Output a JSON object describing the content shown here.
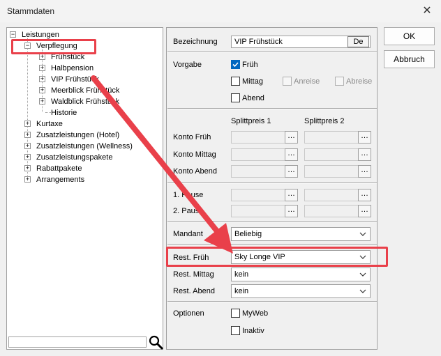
{
  "window": {
    "title": "Stammdaten",
    "close_glyph": "✕"
  },
  "tree": {
    "root": "Leistungen",
    "children": {
      "verpflegung": "Verpflegung",
      "fruehstueck": "Frühstück",
      "halbpension": "Halbpension",
      "vip": "VIP Frühstück",
      "meerblick": "Meerblick Frühstück",
      "waldblick": "Waldblick Frühstück",
      "historie": "Historie",
      "kurtaxe": "Kurtaxe",
      "zusatz_hotel": "Zusatzleistungen (Hotel)",
      "zusatz_wellness": "Zusatzleistungen (Wellness)",
      "zusatzpakete": "Zusatzleistungspakete",
      "rabattpakete": "Rabattpakete",
      "arrangements": "Arrangements"
    },
    "expander_minus": "−",
    "expander_plus": "+"
  },
  "search": {
    "value": "",
    "icon": "search-icon"
  },
  "form": {
    "bezeichnung_label": "Bezeichnung",
    "bezeichnung_value": "VIP Frühstück",
    "lang_button": "De",
    "vorgabe_label": "Vorgabe",
    "vorgabe": {
      "frueh": {
        "label": "Früh",
        "checked": true
      },
      "mittag": {
        "label": "Mittag",
        "checked": false
      },
      "abend": {
        "label": "Abend",
        "checked": false
      },
      "anreise": {
        "label": "Anreise",
        "checked": false,
        "disabled": true
      },
      "abreise": {
        "label": "Abreise",
        "checked": false,
        "disabled": true
      }
    },
    "split1_header": "Splittpreis 1",
    "split2_header": "Splittpreis 2",
    "konto_frueh": "Konto Früh",
    "konto_mittag": "Konto Mittag",
    "konto_abend": "Konto Abend",
    "pause1": "1. Pause",
    "pause2": "2. Pause",
    "dots": "…",
    "mandant_label": "Mandant",
    "mandant_value": "Beliebig",
    "rest_frueh_label": "Rest. Früh",
    "rest_frueh_value": "Sky Longe VIP",
    "rest_mittag_label": "Rest. Mittag",
    "rest_mittag_value": "kein",
    "rest_abend_label": "Rest. Abend",
    "rest_abend_value": "kein",
    "optionen_label": "Optionen",
    "myweb": {
      "label": "MyWeb",
      "checked": false
    },
    "inaktiv": {
      "label": "Inaktiv",
      "checked": false
    }
  },
  "buttons": {
    "ok": "OK",
    "abbruch": "Abbruch"
  },
  "colors": {
    "accent": "#0067c0",
    "annotation": "#e9404a"
  }
}
